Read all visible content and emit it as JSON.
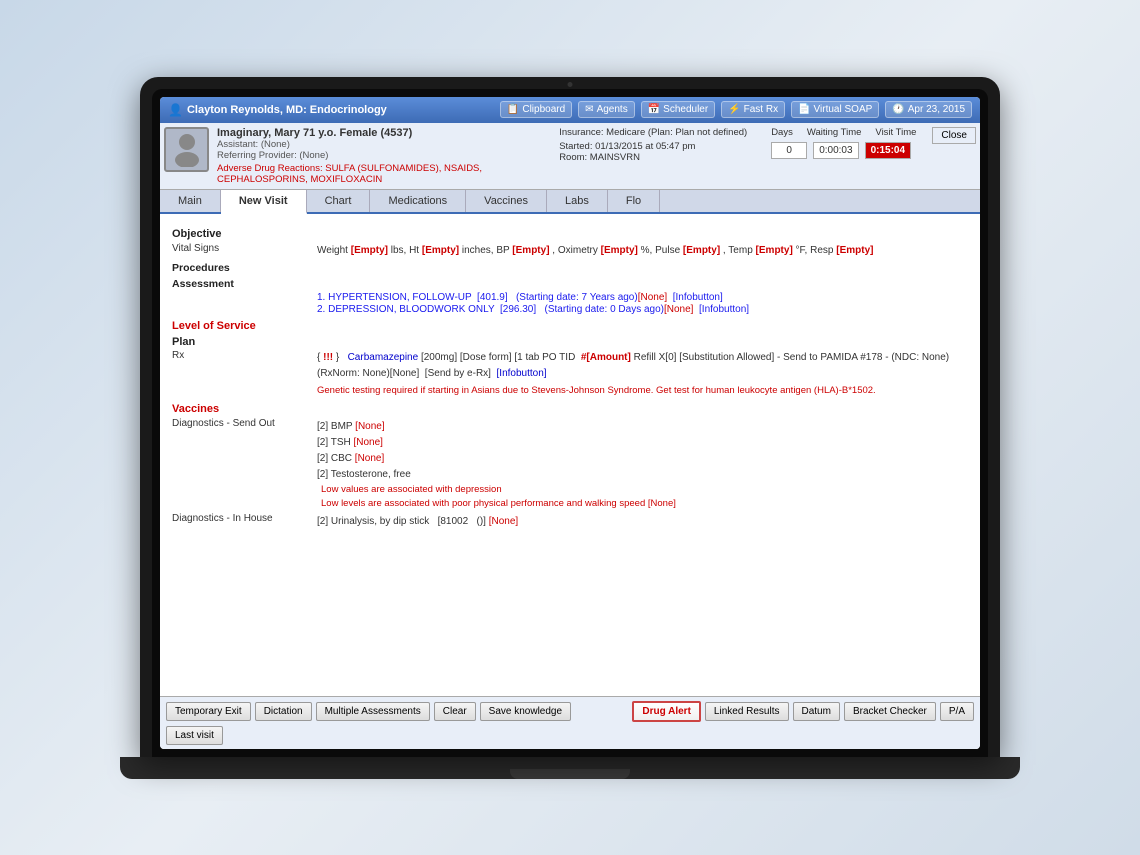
{
  "topbar": {
    "provider": "Clayton Reynolds, MD: Endocrinology",
    "buttons": {
      "clipboard": "Clipboard",
      "agents": "Agents",
      "scheduler": "Scheduler",
      "fast_rx": "Fast Rx",
      "virtual_soap": "Virtual SOAP",
      "date": "Apr 23, 2015"
    }
  },
  "patient": {
    "name": "Imaginary, Mary 71 y.o. Female (4537)",
    "assistant": "Assistant: (None)",
    "referring": "Referring Provider: (None)",
    "adverse_reactions_label": "Adverse Drug Reactions:",
    "adverse_reactions": "SULFA (SULFONAMIDES), NSAIDS, CEPHALOSPORINS, MOXIFLOXACIN",
    "insurance": "Insurance: Medicare (Plan: Plan not defined)",
    "started": "Started: 01/13/2015 at 05:47 pm",
    "room": "Room: MAINSVRN",
    "days_label": "Days",
    "waiting_label": "Waiting Time",
    "visit_label": "Visit Time",
    "days_val": "0",
    "waiting_val": "0:00:03",
    "visit_val": "0:15:04",
    "close": "Close"
  },
  "tabs": {
    "main": "Main",
    "new_visit": "New Visit",
    "chart": "Chart",
    "medications": "Medications",
    "vaccines": "Vaccines",
    "labs": "Labs",
    "flo": "Flo"
  },
  "content": {
    "objective": "Objective",
    "vital_signs": "Vital Signs",
    "vital_signs_value": "Weight [Empty] lbs, Ht [Empty] inches, BP [Empty] , Oximetry [Empty] %, Pulse [Empty] , Temp [Empty] °F, Resp [Empty]",
    "procedures": "Procedures",
    "assessment": "Assessment",
    "assessment_items": [
      "1. HYPERTENSION, FOLLOW-UP  [401.9]   (Starting date: 7 Years ago)[None]  [Infobutton]",
      "2. DEPRESSION, BLOODWORK ONLY  [296.30]   (Starting date: 0 Days ago)[None]  [Infobutton]"
    ],
    "level_of_service": "Level of Service",
    "plan": "Plan",
    "rx_label": "Rx",
    "rx_main": "{ !!! }  Carbamazepine [200mg] [Dose form] [1 tab PO TID  #[Amount] Refill X[0] [Substitution Allowed] - Send to PAMIDA #178 - (NDC: None)",
    "rx_sub": "(RxNorm: None)[None]  [Send by e-Rx]  [Infobutton]",
    "rx_warning": "Genetic testing required if starting in Asians due to Stevens-Johnson Syndrome. Get test for human leukocyte antigen (HLA)-B*1502.",
    "vaccines_header": "Vaccines",
    "diag_sendout_label": "Diagnostics - Send Out",
    "diag_sendout_items": [
      "[2] BMP [None]",
      "[2] TSH [None]",
      "[2] CBC [None]",
      "[2] Testosterone, free"
    ],
    "diag_sendout_notes": [
      "Low values are associated with depression",
      "Low levels are associated with poor physical performance and walking speed [None]"
    ],
    "diag_inhouse_label": "Diagnostics - In House",
    "diag_inhouse_items": [
      "[2] Urinalysis, by dip stick   [81002  ()]  [None]"
    ]
  },
  "bottom_buttons": {
    "temp_exit": "Temporary Exit",
    "dictation": "Dictation",
    "multiple_assessments": "Multiple Assessments",
    "clear": "Clear",
    "save_knowledge": "Save knowledge",
    "drug_alert": "Drug Alert",
    "linked_results": "Linked Results",
    "datum": "Datum",
    "bracket_checker": "Bracket Checker",
    "pia": "P/A",
    "last_visit": "Last visit"
  }
}
